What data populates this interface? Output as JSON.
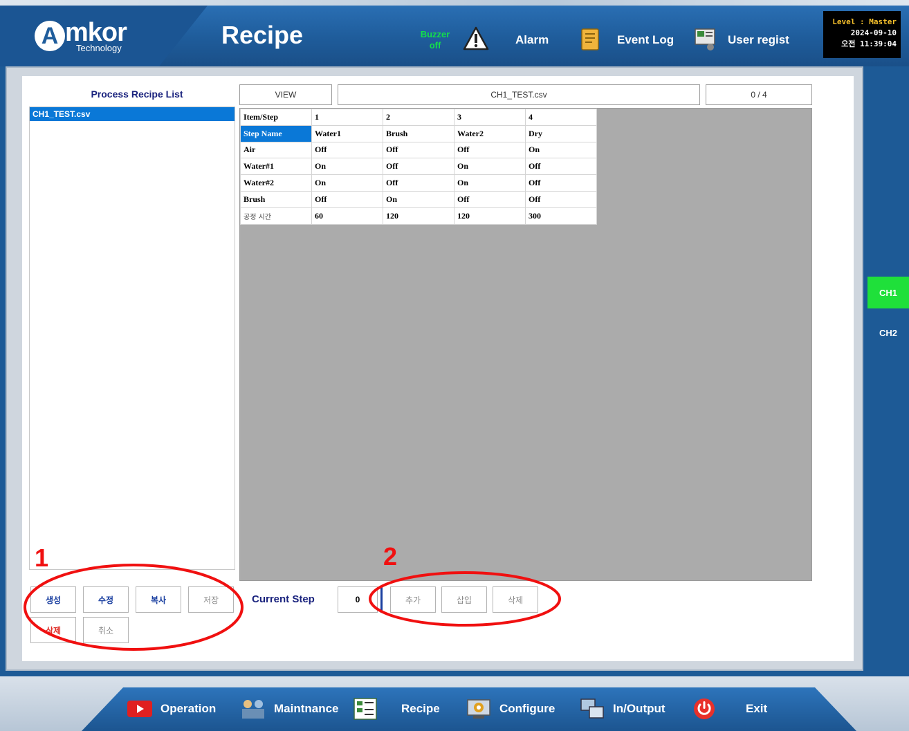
{
  "header": {
    "logo_name": "mkor",
    "logo_letter": "A",
    "logo_sub": "Technology",
    "title": "Recipe",
    "buzzer_line1": "Buzzer",
    "buzzer_line2": "off",
    "alarm_label": "Alarm",
    "event_log_label": "Event Log",
    "user_regist_label": "User regist",
    "level": "Level : Master",
    "date": "2024-09-10",
    "time": "오전 11:39:04"
  },
  "recipe_list": {
    "title": "Process Recipe List",
    "items": [
      "CH1_TEST.csv"
    ]
  },
  "view_bar": {
    "view_label": "VIEW",
    "file_name": "CH1_TEST.csv",
    "counter": "0 / 4"
  },
  "table": {
    "header": [
      "Item/Step",
      "1",
      "2",
      "3",
      "4"
    ],
    "rows": [
      [
        "Step Name",
        "Water1",
        "Brush",
        "Water2",
        "Dry"
      ],
      [
        "Air",
        "Off",
        "Off",
        "Off",
        "On"
      ],
      [
        "Water#1",
        "On",
        "Off",
        "On",
        "Off"
      ],
      [
        "Water#2",
        "On",
        "Off",
        "On",
        "Off"
      ],
      [
        "Brush",
        "Off",
        "On",
        "Off",
        "Off"
      ],
      [
        "공정 시간",
        "60",
        "120",
        "120",
        "300"
      ]
    ]
  },
  "left_buttons": {
    "create": "생성",
    "edit": "수정",
    "copy": "복사",
    "save": "저장",
    "delete": "삭제",
    "cancel": "취소"
  },
  "step_controls": {
    "current_step_label": "Current Step",
    "current_step_value": "0",
    "add": "추가",
    "insert": "삽입",
    "delete": "삭제"
  },
  "annotations": {
    "one": "1",
    "two": "2"
  },
  "channels": {
    "ch1": "CH1",
    "ch2": "CH2"
  },
  "nav": {
    "operation": "Operation",
    "maintenance": "Maintnance",
    "recipe": "Recipe",
    "configure": "Configure",
    "inoutput": "In/Output",
    "exit": "Exit"
  },
  "colors": {
    "accent_blue": "#0a78d7",
    "active_channel": "#1fe03a",
    "annotation_red": "#f01010"
  }
}
